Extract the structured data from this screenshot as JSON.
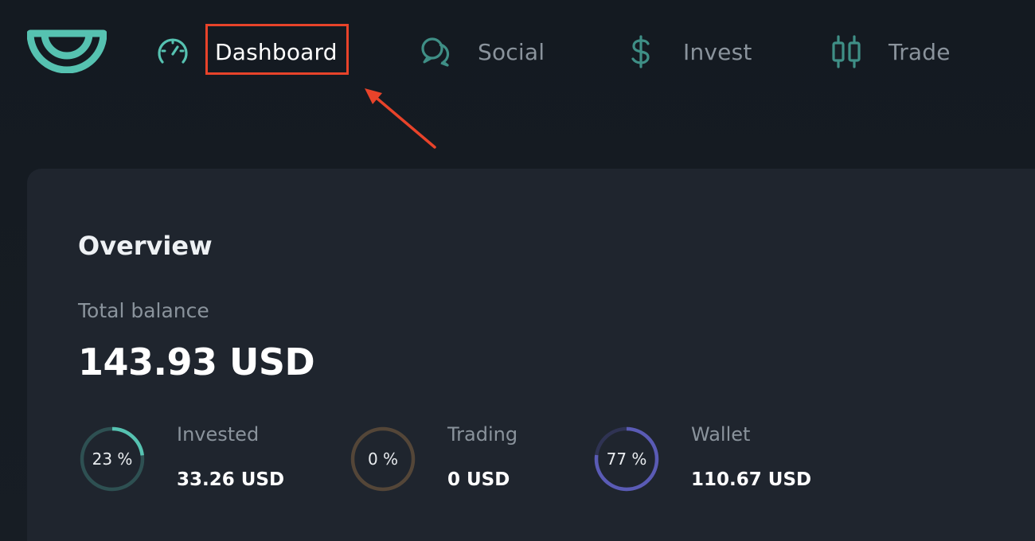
{
  "colors": {
    "accent": "#56c2b1",
    "nav_icon_dim": "#3f8f86",
    "highlight": "#e8432a",
    "invested_ring": "#56c2b1",
    "trading_ring": "#5a4a3a",
    "wallet_ring": "#5a5bb5"
  },
  "nav": {
    "items": [
      {
        "label": "Dashboard",
        "icon": "speedometer-icon",
        "active": true
      },
      {
        "label": "Social",
        "icon": "chat-bubbles-icon",
        "active": false
      },
      {
        "label": "Invest",
        "icon": "dollar-icon",
        "active": false
      },
      {
        "label": "Trade",
        "icon": "candlestick-icon",
        "active": false
      }
    ]
  },
  "overview": {
    "title": "Overview",
    "balance_label": "Total balance",
    "balance_value": "143.93 USD",
    "stats": [
      {
        "percent_text": "23 %",
        "percent": 23,
        "label": "Invested",
        "value": "33.26 USD"
      },
      {
        "percent_text": "0 %",
        "percent": 0,
        "label": "Trading",
        "value": "0 USD"
      },
      {
        "percent_text": "77 %",
        "percent": 77,
        "label": "Wallet",
        "value": "110.67 USD"
      }
    ]
  }
}
